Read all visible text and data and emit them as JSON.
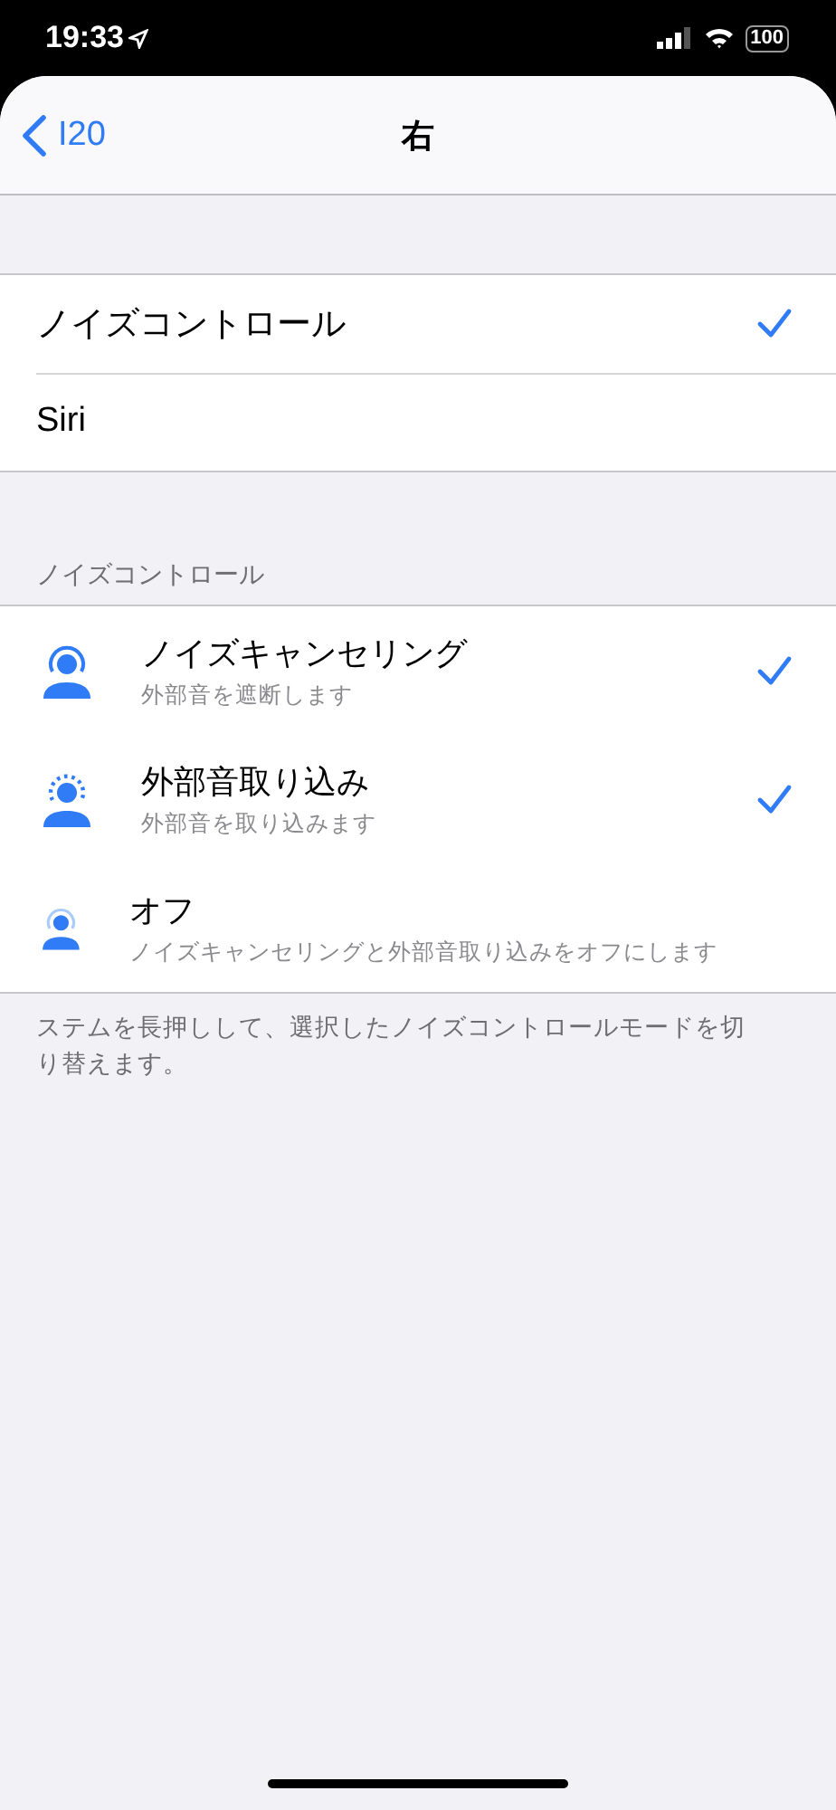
{
  "status_bar": {
    "time": "19:33",
    "battery": "100"
  },
  "nav": {
    "back": "I20",
    "title": "右"
  },
  "press_options": [
    {
      "label": "ノイズコントロール",
      "selected": true
    },
    {
      "label": "Siri",
      "selected": false
    }
  ],
  "noise_control": {
    "header": "ノイズコントロール",
    "modes": [
      {
        "kind": "cancel",
        "title": "ノイズキャンセリング",
        "subtitle": "外部音を遮断します",
        "selected": true
      },
      {
        "kind": "transparency",
        "title": "外部音取り込み",
        "subtitle": "外部音を取り込みます",
        "selected": true
      },
      {
        "kind": "off",
        "title": "オフ",
        "subtitle": "ノイズキャンセリングと外部音取り込みをオフにします",
        "selected": false
      }
    ],
    "footer": "ステムを長押しして、選択したノイズコントロールモードを切り替えます。"
  }
}
